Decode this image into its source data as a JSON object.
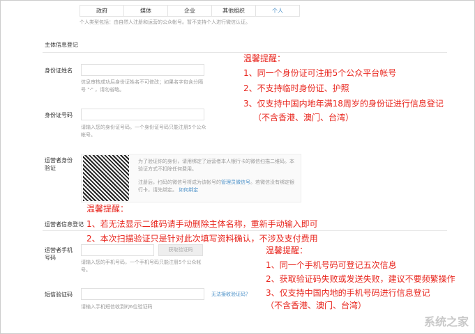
{
  "tabs": [
    "政府",
    "媒体",
    "企业",
    "其他组织",
    "个人"
  ],
  "type_desc": "个人类型包括：由自然人注册和运营的公众帐号。暂不支持个人进行微信认证。",
  "section_title": "主体信息登记",
  "id_name": {
    "label": "身份证姓名",
    "value": "",
    "hint": "信息审核成功后身份证姓名不可修改；如果名字包含分隔号 \"·\" ，请勿省略。"
  },
  "id_number": {
    "label": "身份证号码",
    "value": "",
    "hint": "请输入您的身份证号码。一个身份证号码只能注册5个公众帐号。"
  },
  "operator_verify": {
    "label": "运营者身份验证",
    "text1": "为了验证你的身份，请用绑定了运营者本人银行卡的微信扫描二维码。本验证方式不扣除任何费用。",
    "text2a": "注册后，扫码的微信号将成为该帐号的",
    "text2_link": "管理员微信号",
    "text2b": "。若微信没有绑定银行卡，请先绑定。",
    "how_link": "如何绑定"
  },
  "operator_info_label": "运营者信息登记",
  "phone": {
    "label": "运营者手机号码",
    "value": "",
    "button": "获取验证码",
    "hint": "请输入您的手机号码，一个手机号码只能注册5个公众帐号。"
  },
  "sms": {
    "label": "短信验证码",
    "value": "",
    "link": "无法接收验证码？",
    "hint": "请输入手机短信收到的6位验证码"
  },
  "tip1": {
    "title": "温馨提醒：",
    "lines": [
      "1、同一个身份证可注册5个公众平台帐号",
      "2、不支持临时身份证、护照",
      "3、仅支持中国内地年满18周岁的身份证进行信息登记",
      "（不含香港、澳门、台湾）"
    ]
  },
  "tip2": {
    "title": "温馨提醒：",
    "lines": [
      "1、若无法显示二维码请手动删除主体名称，重新手动输入即可",
      "2、本次扫描验证只是针对此次填写资料确认，不涉及支付费用"
    ]
  },
  "tip3": {
    "title": "温馨提醒：",
    "lines": [
      "1、同一个手机号码可登记五次信息",
      "2、获取验证码失败或发送失败，建议不要频繁操作",
      "3、仅支持中国内地的手机号码进行信息登记",
      "（不含香港、澳门、台湾）"
    ]
  },
  "watermark": "系统之家",
  "colors": {
    "red": "#e8261e",
    "link": "#4a90c8"
  }
}
